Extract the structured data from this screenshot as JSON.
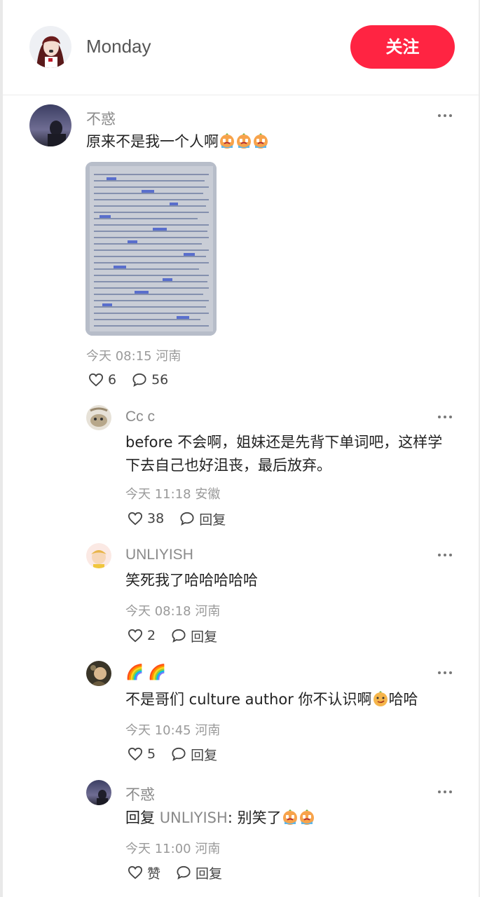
{
  "header": {
    "author_name": "Monday",
    "follow_label": "关注"
  },
  "main_comment": {
    "username": "不惑",
    "text": "原来不是我一个人啊",
    "emoji": "crying-face-emoji",
    "time": "今天 08:15",
    "location": "河南",
    "likes": "6",
    "replies": "56"
  },
  "replies": [
    {
      "username": "Cc c",
      "line1": "before 不会啊，姐妹还是先背下单词吧，这样学",
      "line2": "下去自己也好沮丧，最后放弃。",
      "time": "今天 11:18",
      "location": "安徽",
      "likes": "38",
      "reply_label": "回复"
    },
    {
      "username": "UNLIYISH",
      "text": "笑死我了哈哈哈哈哈",
      "time": "今天 08:18",
      "location": "河南",
      "likes": "2",
      "reply_label": "回复"
    },
    {
      "username": "🌈 🌈",
      "text_a": "不是哥们 culture author 你不认识啊",
      "text_b": "哈哈",
      "time": "今天 10:45",
      "location": "河南",
      "likes": "5",
      "reply_label": "回复"
    },
    {
      "username": "不惑",
      "reply_prefix": "回复 ",
      "reply_target": "UNLIYISH",
      "text": ": 别笑了",
      "time": "今天 11:00",
      "location": "河南",
      "likes": "赞",
      "reply_label": "回复"
    }
  ],
  "colors": {
    "accent": "#ff2442",
    "muted": "#8a8a8a"
  }
}
